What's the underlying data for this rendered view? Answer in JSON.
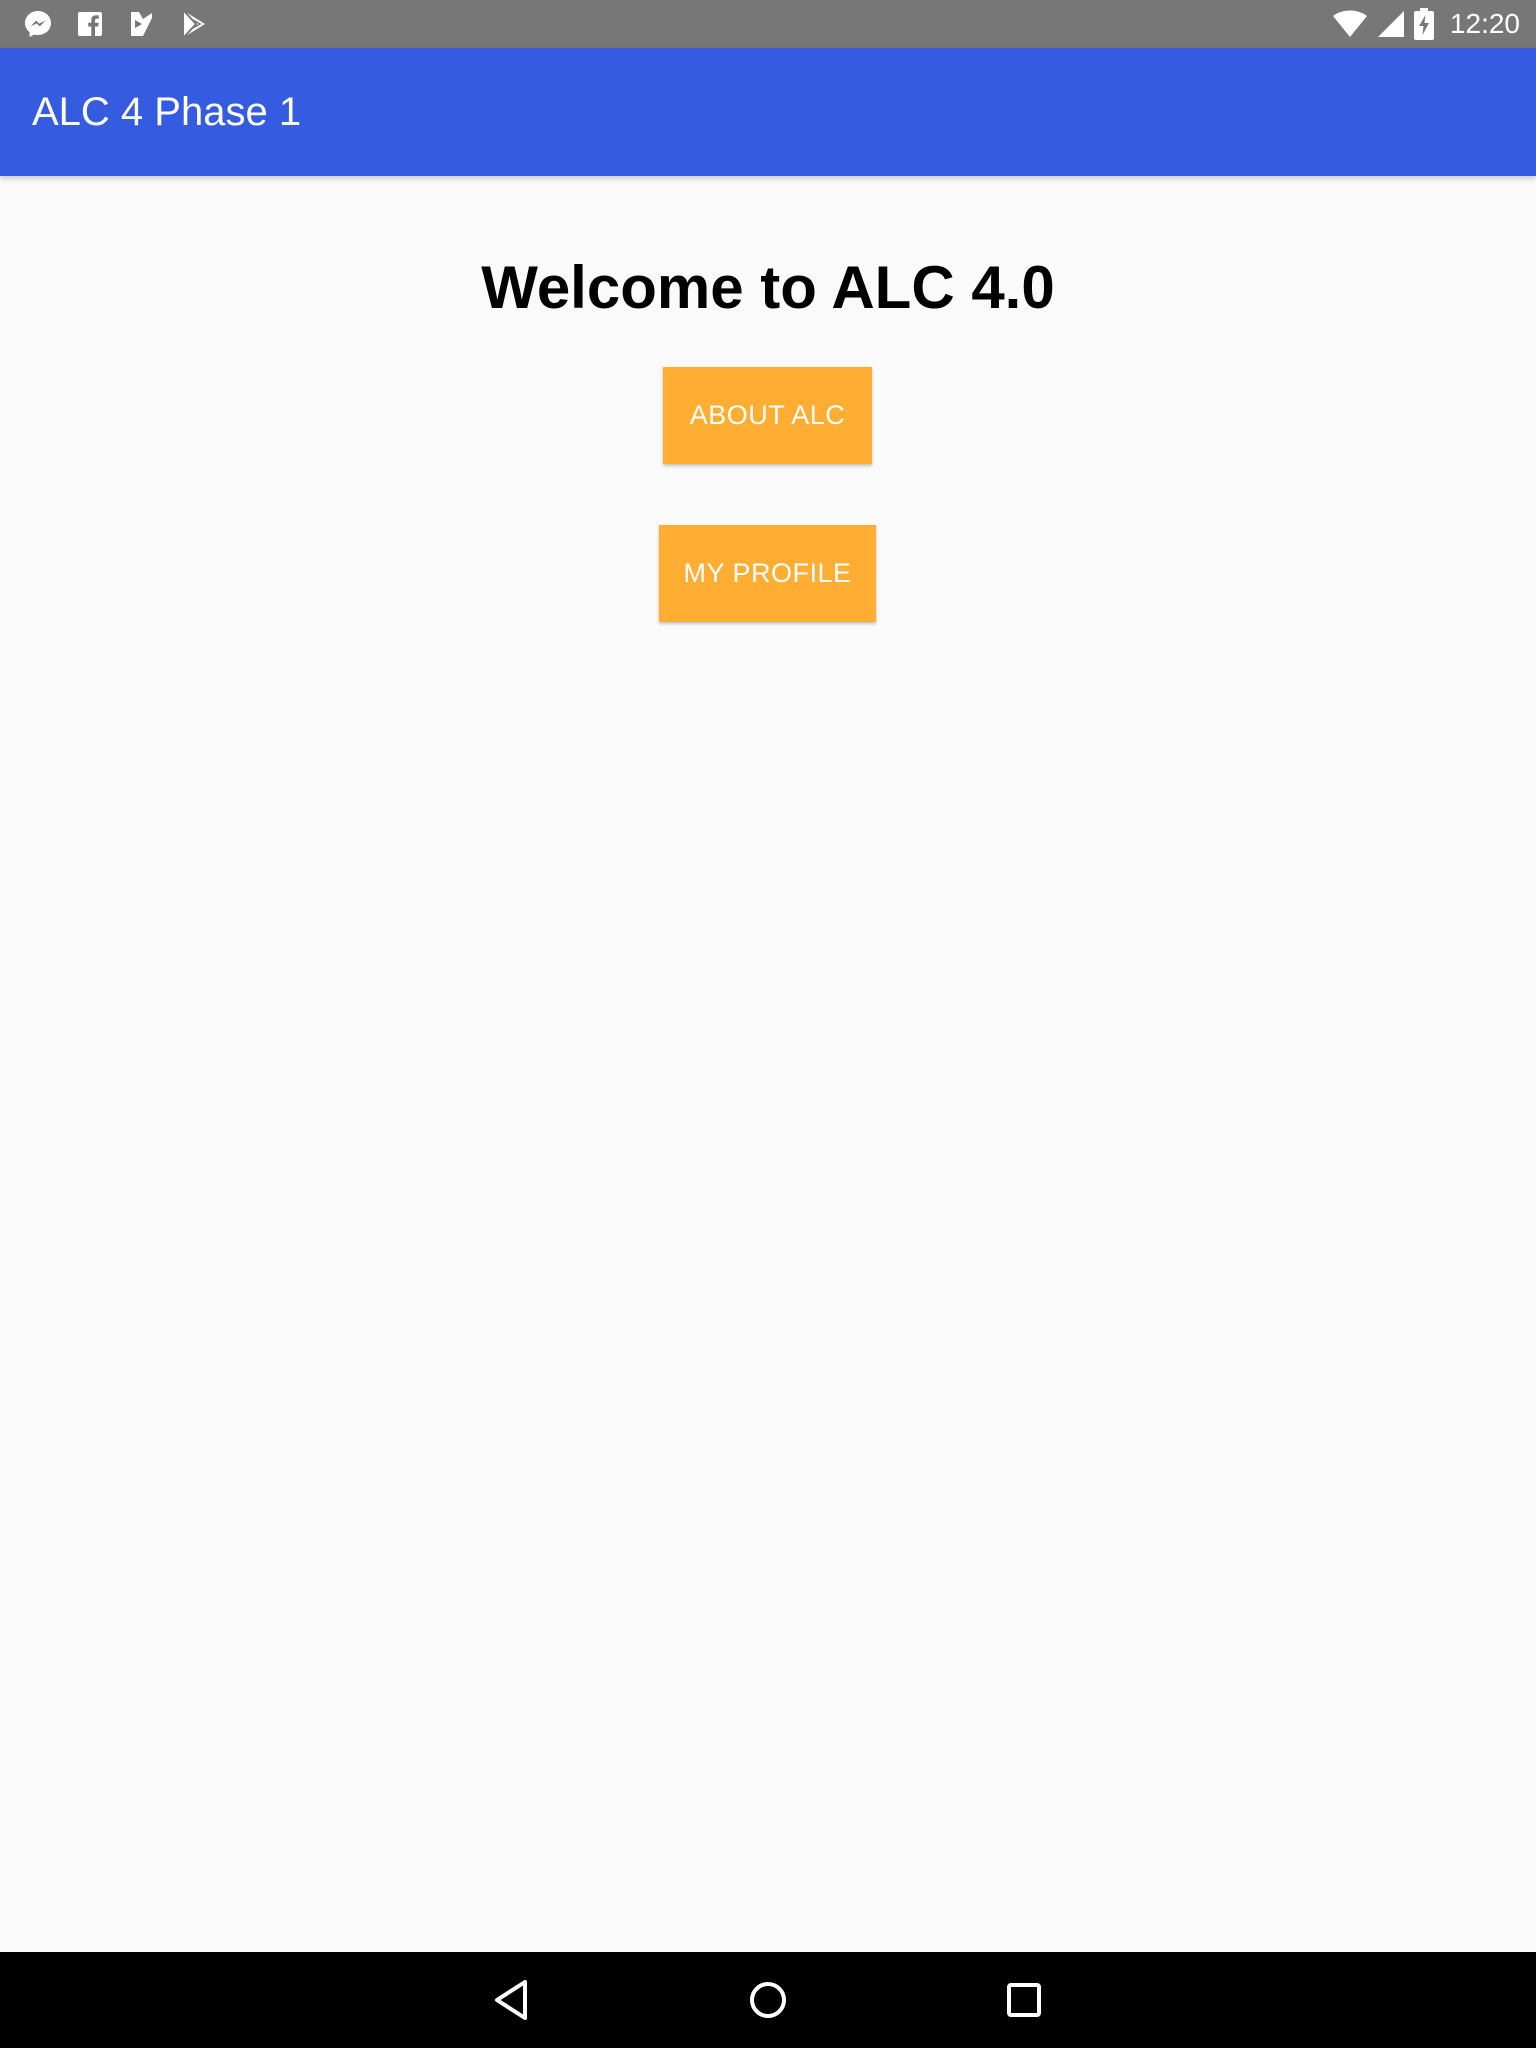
{
  "status_bar": {
    "time": "12:20",
    "left_icons": [
      "messenger-icon",
      "facebook-icon",
      "play-movies-icon",
      "play-store-icon"
    ],
    "right_icons": [
      "wifi-icon",
      "cell-signal-icon",
      "battery-charging-icon"
    ],
    "background": "#777777"
  },
  "app_bar": {
    "title": "ALC 4 Phase 1",
    "background": "#345be0"
  },
  "main": {
    "heading": "Welcome to ALC 4.0",
    "buttons": [
      {
        "label": "ABOUT ALC"
      },
      {
        "label": "MY PROFILE"
      }
    ],
    "button_color": "#ffad33"
  },
  "nav_bar": {
    "icons": [
      "back-icon",
      "home-icon",
      "recents-icon"
    ],
    "background": "#000000"
  }
}
